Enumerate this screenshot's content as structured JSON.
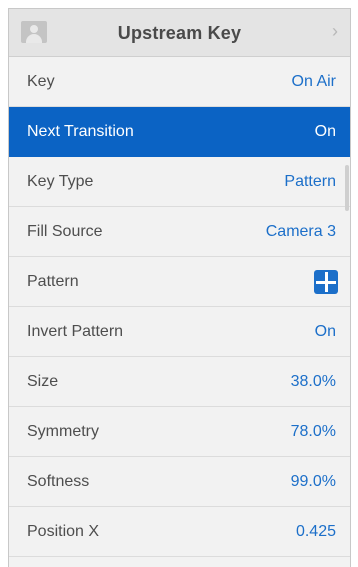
{
  "header": {
    "title": "Upstream Key",
    "avatar_icon": "person-icon",
    "chevron": "›"
  },
  "rows": [
    {
      "label": "Key",
      "value": "On Air"
    },
    {
      "label": "Next Transition",
      "value": "On",
      "selected": true
    },
    {
      "label": "Key Type",
      "value": "Pattern"
    },
    {
      "label": "Fill Source",
      "value": "Camera 3"
    },
    {
      "label": "Pattern",
      "icon": "cross-pattern-icon"
    },
    {
      "label": "Invert Pattern",
      "value": "On"
    },
    {
      "label": "Size",
      "value": "38.0%"
    },
    {
      "label": "Symmetry",
      "value": "78.0%"
    },
    {
      "label": "Softness",
      "value": "99.0%"
    },
    {
      "label": "Position X",
      "value": "0.425"
    }
  ],
  "colors": {
    "accent": "#1c6fc9",
    "selected_bg": "#0b63c4",
    "header_bg": "#e4e4e4",
    "row_bg": "#f2f2f2"
  }
}
